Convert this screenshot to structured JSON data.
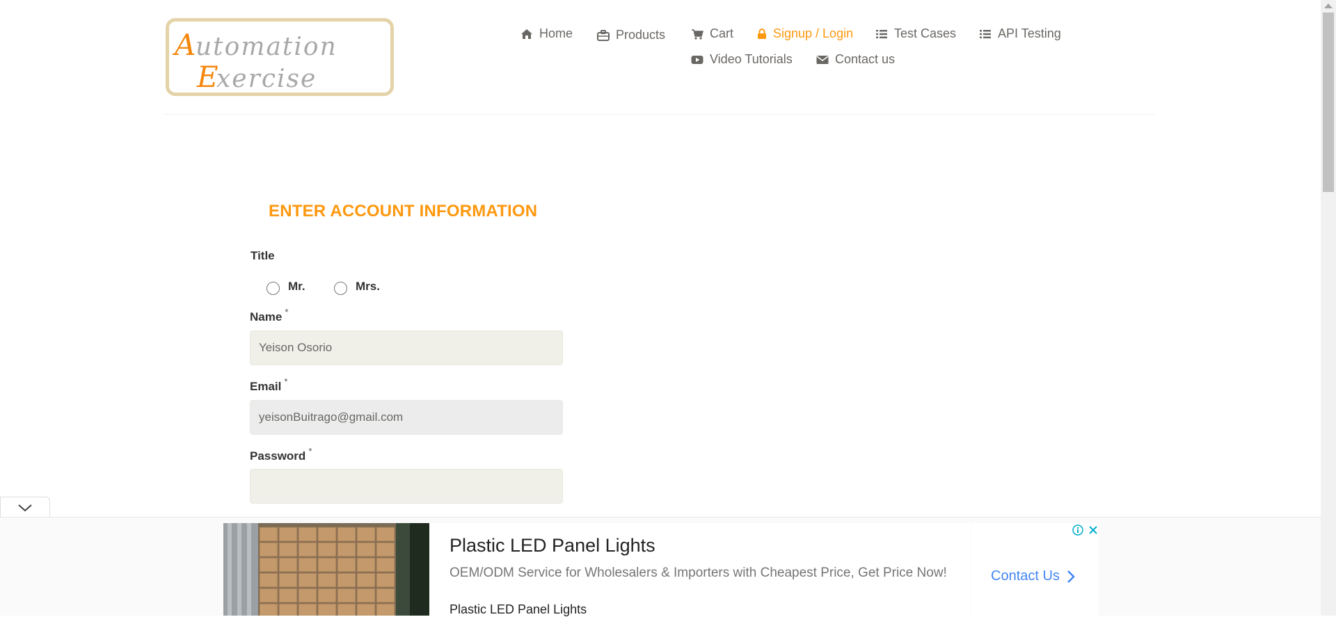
{
  "brand": {
    "logo_text": "Automation Exercise"
  },
  "nav": {
    "items": [
      {
        "label": "Home",
        "icon": "home-icon"
      },
      {
        "label": "Products",
        "icon": "briefcase-icon"
      },
      {
        "label": "Cart",
        "icon": "cart-icon"
      },
      {
        "label": "Signup / Login",
        "icon": "lock-icon",
        "active": true
      },
      {
        "label": "Test Cases",
        "icon": "list-icon"
      },
      {
        "label": "API Testing",
        "icon": "list-icon"
      },
      {
        "label": "Video Tutorials",
        "icon": "youtube-icon"
      },
      {
        "label": "Contact us",
        "icon": "envelope-icon"
      }
    ]
  },
  "form": {
    "heading": "ENTER ACCOUNT INFORMATION",
    "title_label": "Title",
    "title_options": [
      "Mr.",
      "Mrs."
    ],
    "name_label": "Name",
    "name_value": "Yeison Osorio",
    "email_label": "Email",
    "email_value": "yeisonBuitrago@gmail.com",
    "password_label": "Password",
    "password_value": "",
    "required_mark": "*"
  },
  "ad": {
    "title": "Plastic LED Panel Lights",
    "description": "OEM/ODM Service for Wholesalers & Importers with Cheapest Price, Get Price Now!",
    "subtitle": "Plastic LED Panel Lights",
    "cta": "Contact Us"
  },
  "colors": {
    "accent": "#fe980f",
    "text": "#696763",
    "field_bg": "#f0f0e9",
    "link_blue": "#4285f4"
  }
}
